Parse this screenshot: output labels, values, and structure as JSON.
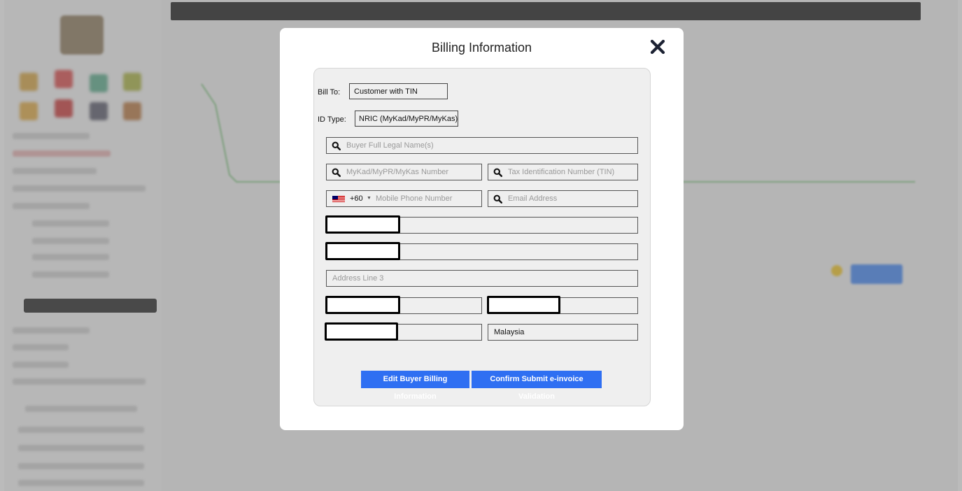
{
  "modal": {
    "title": "Billing Information",
    "close_icon": "close-icon"
  },
  "form": {
    "bill_to_label": "Bill To:",
    "bill_to_value": "Customer with TIN",
    "id_type_label": "ID Type:",
    "id_type_value": "NRIC (MyKad/MyPR/MyKas)",
    "buyer_name_placeholder": "Buyer Full Legal Name(s)",
    "id_number_placeholder": "MyKad/MyPR/MyKas Number",
    "tin_placeholder": "Tax Identification Number (TIN)",
    "phone_country_code": "+60",
    "phone_placeholder": "Mobile Phone Number",
    "email_placeholder": "Email Address",
    "address_line3_placeholder": "Address Line 3",
    "country_value": "Malaysia"
  },
  "buttons": {
    "edit": "Edit Buyer Billing Information",
    "confirm": "Confirm Submit e-invoice Validation"
  },
  "colors": {
    "primary_button": "#2f6ff2",
    "overlay": "rgba(120,120,120,0.5)"
  }
}
